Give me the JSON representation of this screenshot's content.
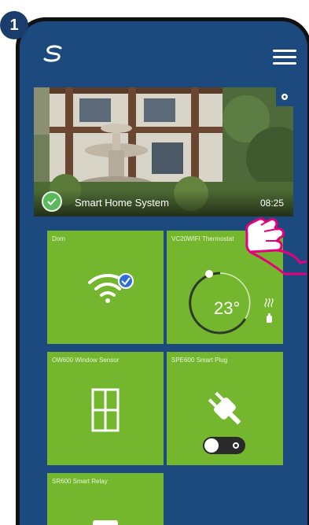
{
  "step_number": "1",
  "banner": {
    "title": "Smart Home System",
    "time": "08:25"
  },
  "tiles": [
    {
      "label": "Dom"
    },
    {
      "label": "VC20WIFI Thermostat",
      "temperature": "23°"
    },
    {
      "label": "OW600 Window Sensor"
    },
    {
      "label": "SPE600 Smart Plug",
      "switch_on": true
    },
    {
      "label": "SR600 Smart Relay"
    }
  ],
  "colors": {
    "header": "#1d4a7e",
    "tile": "#74b72e",
    "badge": "#1a3d6b",
    "check": "#5cb85c"
  },
  "icons": [
    "salus-logo-icon",
    "hamburger-menu-icon",
    "gear-icon",
    "check-icon",
    "wifi-icon",
    "thermostat-dial-icon",
    "heat-waves-icon",
    "hand-icon",
    "window-icon",
    "plug-icon",
    "relay-icon",
    "pointing-hand-icon"
  ]
}
